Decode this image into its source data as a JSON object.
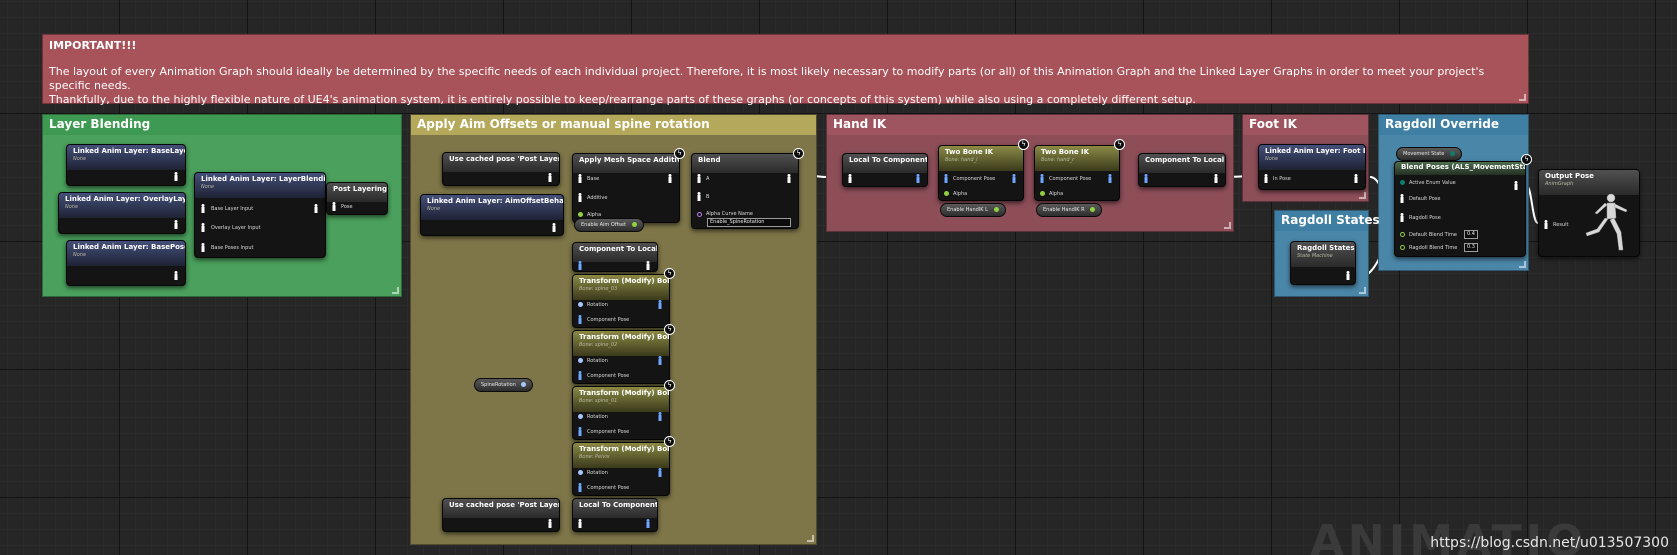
{
  "comments": {
    "important": {
      "title": "IMPORTANT!!!",
      "line1": "The layout of every Animation Graph should ideally be determined by the specific needs of each individual project. Therefore, it is most likely necessary to modify parts (or all) of this Animation Graph and the Linked Layer Graphs in order to meet your project's specific needs.",
      "line2": "Thankfully, due to the highly flexible nature of UE4's animation system, it is entirely possible to keep/rearrange parts of these graphs (or concepts of this system) while also using a completely different setup.",
      "color": "#a8525a"
    },
    "layer_blending": {
      "title": "Layer Blending",
      "color": "#4aa05c"
    },
    "aim_offsets": {
      "title": "Apply Aim Offsets or manual spine rotation",
      "color": "#7e7648"
    },
    "hand_ik": {
      "title": "Hand IK",
      "color": "#8d4e58"
    },
    "foot_ik": {
      "title": "Foot IK",
      "color": "#8d4e58"
    },
    "ragdoll_override": {
      "title": "Ragdoll Override",
      "color": "#4a86a8"
    },
    "ragdoll_states": {
      "title": "Ragdoll States",
      "color": "#4a86a8"
    }
  },
  "nodes": {
    "base_layer": {
      "title": "Linked Anim Layer: BaseLayer",
      "sub": "None"
    },
    "overlay_layer": {
      "title": "Linked Anim Layer: OverlayLayer",
      "sub": "None"
    },
    "base_poses": {
      "title": "Linked Anim Layer: BasePoses",
      "sub": "None"
    },
    "layer_blending": {
      "title": "Linked Anim Layer: LayerBlending",
      "sub": "None",
      "pins": [
        "Base Layer Input",
        "Overlay Layer Input",
        "Base Poses Input"
      ]
    },
    "post_layering": {
      "title": "Post Layering",
      "pin": "Pose"
    },
    "cached_pose_1": {
      "title": "Use cached pose 'Post Layering'"
    },
    "aim_offset_behaviors": {
      "title": "Linked Anim Layer: AimOffsetBehaviors",
      "sub": "None"
    },
    "apply_mesh_space_additive": {
      "title": "Apply Mesh Space Additive",
      "pins": [
        "Base",
        "Additive",
        "Alpha"
      ]
    },
    "enable_aim_offset": {
      "label": "Enable Aim Offset"
    },
    "blend": {
      "title": "Blend",
      "pins": [
        "A",
        "B",
        "Alpha Curve Name"
      ],
      "curve_value": "Enable_SpineRotation"
    },
    "component_to_local_1": {
      "title": "Component To Local"
    },
    "transform_bones": [
      {
        "title": "Transform (Modify) Bone",
        "sub": "Bone: spine_03"
      },
      {
        "title": "Transform (Modify) Bone",
        "sub": "Bone: spine_02"
      },
      {
        "title": "Transform (Modify) Bone",
        "sub": "Bone: spine_01"
      },
      {
        "title": "Transform (Modify) Bone",
        "sub": "Bone: Pelvis"
      }
    ],
    "transform_pins": [
      "Rotation",
      "Component Pose"
    ],
    "spine_rotation": {
      "label": "SpineRotation"
    },
    "cached_pose_2": {
      "title": "Use cached pose 'Post Layering'"
    },
    "local_to_component_2": {
      "title": "Local To Component"
    },
    "local_to_component": {
      "title": "Local To Component"
    },
    "two_bone_ik_l": {
      "title": "Two Bone IK",
      "sub": "Bone: hand_l",
      "pins": [
        "Component Pose",
        "Alpha"
      ]
    },
    "two_bone_ik_r": {
      "title": "Two Bone IK",
      "sub": "Bone: hand_r",
      "pins": [
        "Component Pose",
        "Alpha"
      ]
    },
    "enable_hand_ik_l": {
      "label": "Enable HandIK L"
    },
    "enable_hand_ik_r": {
      "label": "Enable HandIK R"
    },
    "component_to_local": {
      "title": "Component To Local"
    },
    "foot_ik": {
      "title": "Linked Anim Layer: Foot IK",
      "sub": "None",
      "pin": "In Pose"
    },
    "movement_state": {
      "label": "Movement State"
    },
    "blend_poses": {
      "title": "Blend Poses (ALS_MovementState)",
      "pins": [
        "Active Enum Value",
        "Default Pose",
        "Ragdoll Pose",
        "Default Blend Time",
        "Ragdoll Blend Time"
      ],
      "default_blend_time": "0.4",
      "ragdoll_blend_time": "0.3"
    },
    "ragdoll_states": {
      "title": "Ragdoll States",
      "sub": "State Machine"
    },
    "output_pose": {
      "title": "Output Pose",
      "sub": "AnimGraph",
      "pin": "Result"
    }
  },
  "watermark": "https://blog.csdn.net/u013507300",
  "background_text": "ANIMATIO",
  "colors": {
    "pose_pin": "#ffffff",
    "component_pin": "#6fa8ff",
    "bool_pin": "#8fd13f",
    "name_pin": "#c77cf0",
    "rotator_pin": "#a6c8ff"
  }
}
